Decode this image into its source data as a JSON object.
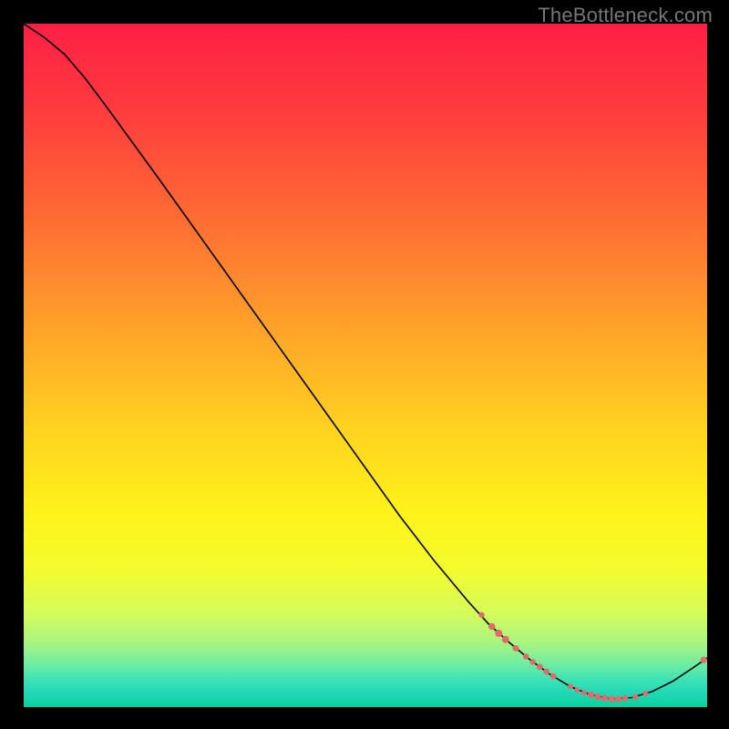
{
  "watermark": "TheBottleneck.com",
  "chart_data": {
    "type": "line",
    "title": "",
    "xlabel": "",
    "ylabel": "",
    "xlim": [
      0,
      100
    ],
    "ylim": [
      0,
      100
    ],
    "gradient_stops": [
      {
        "offset": 0.0,
        "color": "#ff1f44"
      },
      {
        "offset": 0.12,
        "color": "#ff3a3f"
      },
      {
        "offset": 0.28,
        "color": "#ff6a33"
      },
      {
        "offset": 0.45,
        "color": "#ffa329"
      },
      {
        "offset": 0.6,
        "color": "#ffd41f"
      },
      {
        "offset": 0.72,
        "color": "#fef31a"
      },
      {
        "offset": 0.8,
        "color": "#f3fb2e"
      },
      {
        "offset": 0.86,
        "color": "#d6fb58"
      },
      {
        "offset": 0.905,
        "color": "#a9f57f"
      },
      {
        "offset": 0.935,
        "color": "#72eda0"
      },
      {
        "offset": 0.958,
        "color": "#41e3b4"
      },
      {
        "offset": 0.978,
        "color": "#22d9b6"
      },
      {
        "offset": 1.0,
        "color": "#0ccf9e"
      }
    ],
    "curve": [
      {
        "x": 0,
        "y": 100.0
      },
      {
        "x": 3,
        "y": 98.0
      },
      {
        "x": 6,
        "y": 95.5
      },
      {
        "x": 9,
        "y": 92.0
      },
      {
        "x": 12,
        "y": 88.0
      },
      {
        "x": 16,
        "y": 82.5
      },
      {
        "x": 20,
        "y": 77.0
      },
      {
        "x": 25,
        "y": 70.0
      },
      {
        "x": 30,
        "y": 63.0
      },
      {
        "x": 35,
        "y": 56.0
      },
      {
        "x": 40,
        "y": 49.0
      },
      {
        "x": 45,
        "y": 42.0
      },
      {
        "x": 50,
        "y": 35.0
      },
      {
        "x": 55,
        "y": 28.0
      },
      {
        "x": 60,
        "y": 21.5
      },
      {
        "x": 65,
        "y": 15.5
      },
      {
        "x": 68,
        "y": 12.2
      },
      {
        "x": 71,
        "y": 9.5
      },
      {
        "x": 74,
        "y": 7.0
      },
      {
        "x": 77,
        "y": 4.8
      },
      {
        "x": 80,
        "y": 3.0
      },
      {
        "x": 83,
        "y": 1.8
      },
      {
        "x": 86,
        "y": 1.2
      },
      {
        "x": 89,
        "y": 1.4
      },
      {
        "x": 92,
        "y": 2.3
      },
      {
        "x": 95,
        "y": 3.8
      },
      {
        "x": 98,
        "y": 5.8
      },
      {
        "x": 100,
        "y": 7.2
      }
    ],
    "markers": [
      {
        "x": 67.0,
        "y": 13.5,
        "r": 3.2
      },
      {
        "x": 68.5,
        "y": 11.8,
        "r": 3.8
      },
      {
        "x": 69.5,
        "y": 10.8,
        "r": 4.0
      },
      {
        "x": 70.5,
        "y": 9.9,
        "r": 4.0
      },
      {
        "x": 72.0,
        "y": 8.6,
        "r": 3.5
      },
      {
        "x": 73.5,
        "y": 7.4,
        "r": 3.2
      },
      {
        "x": 74.5,
        "y": 6.6,
        "r": 3.2
      },
      {
        "x": 75.5,
        "y": 5.9,
        "r": 3.4
      },
      {
        "x": 76.5,
        "y": 5.2,
        "r": 3.4
      },
      {
        "x": 77.5,
        "y": 4.5,
        "r": 3.4
      },
      {
        "x": 80.0,
        "y": 3.0,
        "r": 3.0
      },
      {
        "x": 81.0,
        "y": 2.5,
        "r": 3.0
      },
      {
        "x": 82.0,
        "y": 2.1,
        "r": 3.0
      },
      {
        "x": 83.0,
        "y": 1.8,
        "r": 3.6
      },
      {
        "x": 84.0,
        "y": 1.5,
        "r": 3.6
      },
      {
        "x": 85.0,
        "y": 1.3,
        "r": 3.6
      },
      {
        "x": 86.0,
        "y": 1.2,
        "r": 3.6
      },
      {
        "x": 87.0,
        "y": 1.2,
        "r": 3.6
      },
      {
        "x": 88.0,
        "y": 1.3,
        "r": 3.4
      },
      {
        "x": 89.5,
        "y": 1.5,
        "r": 3.2
      },
      {
        "x": 91.0,
        "y": 2.0,
        "r": 3.0
      },
      {
        "x": 99.5,
        "y": 6.9,
        "r": 3.6
      }
    ],
    "marker_color": "#e26a6a",
    "curve_color": "#000000"
  }
}
